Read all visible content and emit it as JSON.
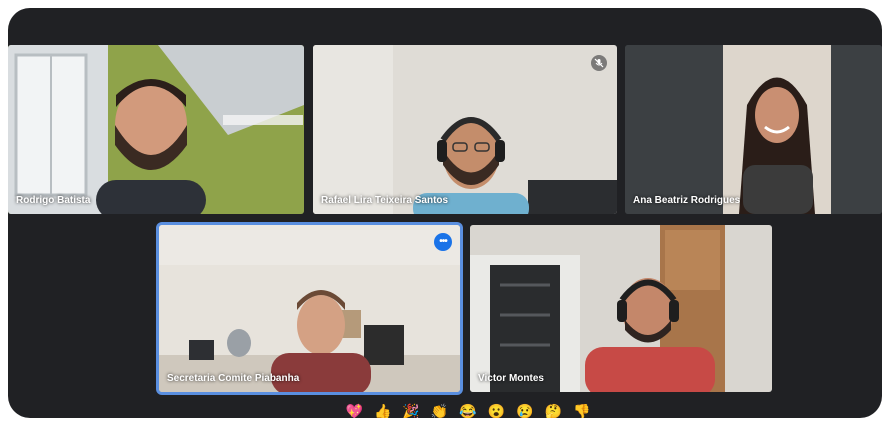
{
  "participants": [
    {
      "name": "Rodrigo Batista",
      "mic_muted": false,
      "active": false
    },
    {
      "name": "Rafael Lira Teixeira Santos",
      "mic_muted": true,
      "active": false
    },
    {
      "name": "Ana Beatriz Rodrigues",
      "mic_muted": false,
      "active": false
    },
    {
      "name": "Secretaria Comite Piabanha",
      "mic_muted": false,
      "active": true
    },
    {
      "name": "Victor Montes",
      "mic_muted": false,
      "active": false
    }
  ],
  "more_options_label": "•••",
  "reactions": [
    {
      "icon": "sparkling-heart-icon",
      "glyph": "💖"
    },
    {
      "icon": "thumbs-up-icon",
      "glyph": "👍"
    },
    {
      "icon": "party-popper-icon",
      "glyph": "🎉"
    },
    {
      "icon": "clapping-hands-icon",
      "glyph": "👏"
    },
    {
      "icon": "tears-of-joy-icon",
      "glyph": "😂"
    },
    {
      "icon": "surprised-face-icon",
      "glyph": "😮"
    },
    {
      "icon": "crying-face-icon",
      "glyph": "😢"
    },
    {
      "icon": "thinking-face-icon",
      "glyph": "🤔"
    },
    {
      "icon": "thumbs-down-icon",
      "glyph": "👎"
    }
  ],
  "colors": {
    "background": "#202124",
    "active_border": "#5a8fe0",
    "badge_blue": "#1a73e8"
  }
}
